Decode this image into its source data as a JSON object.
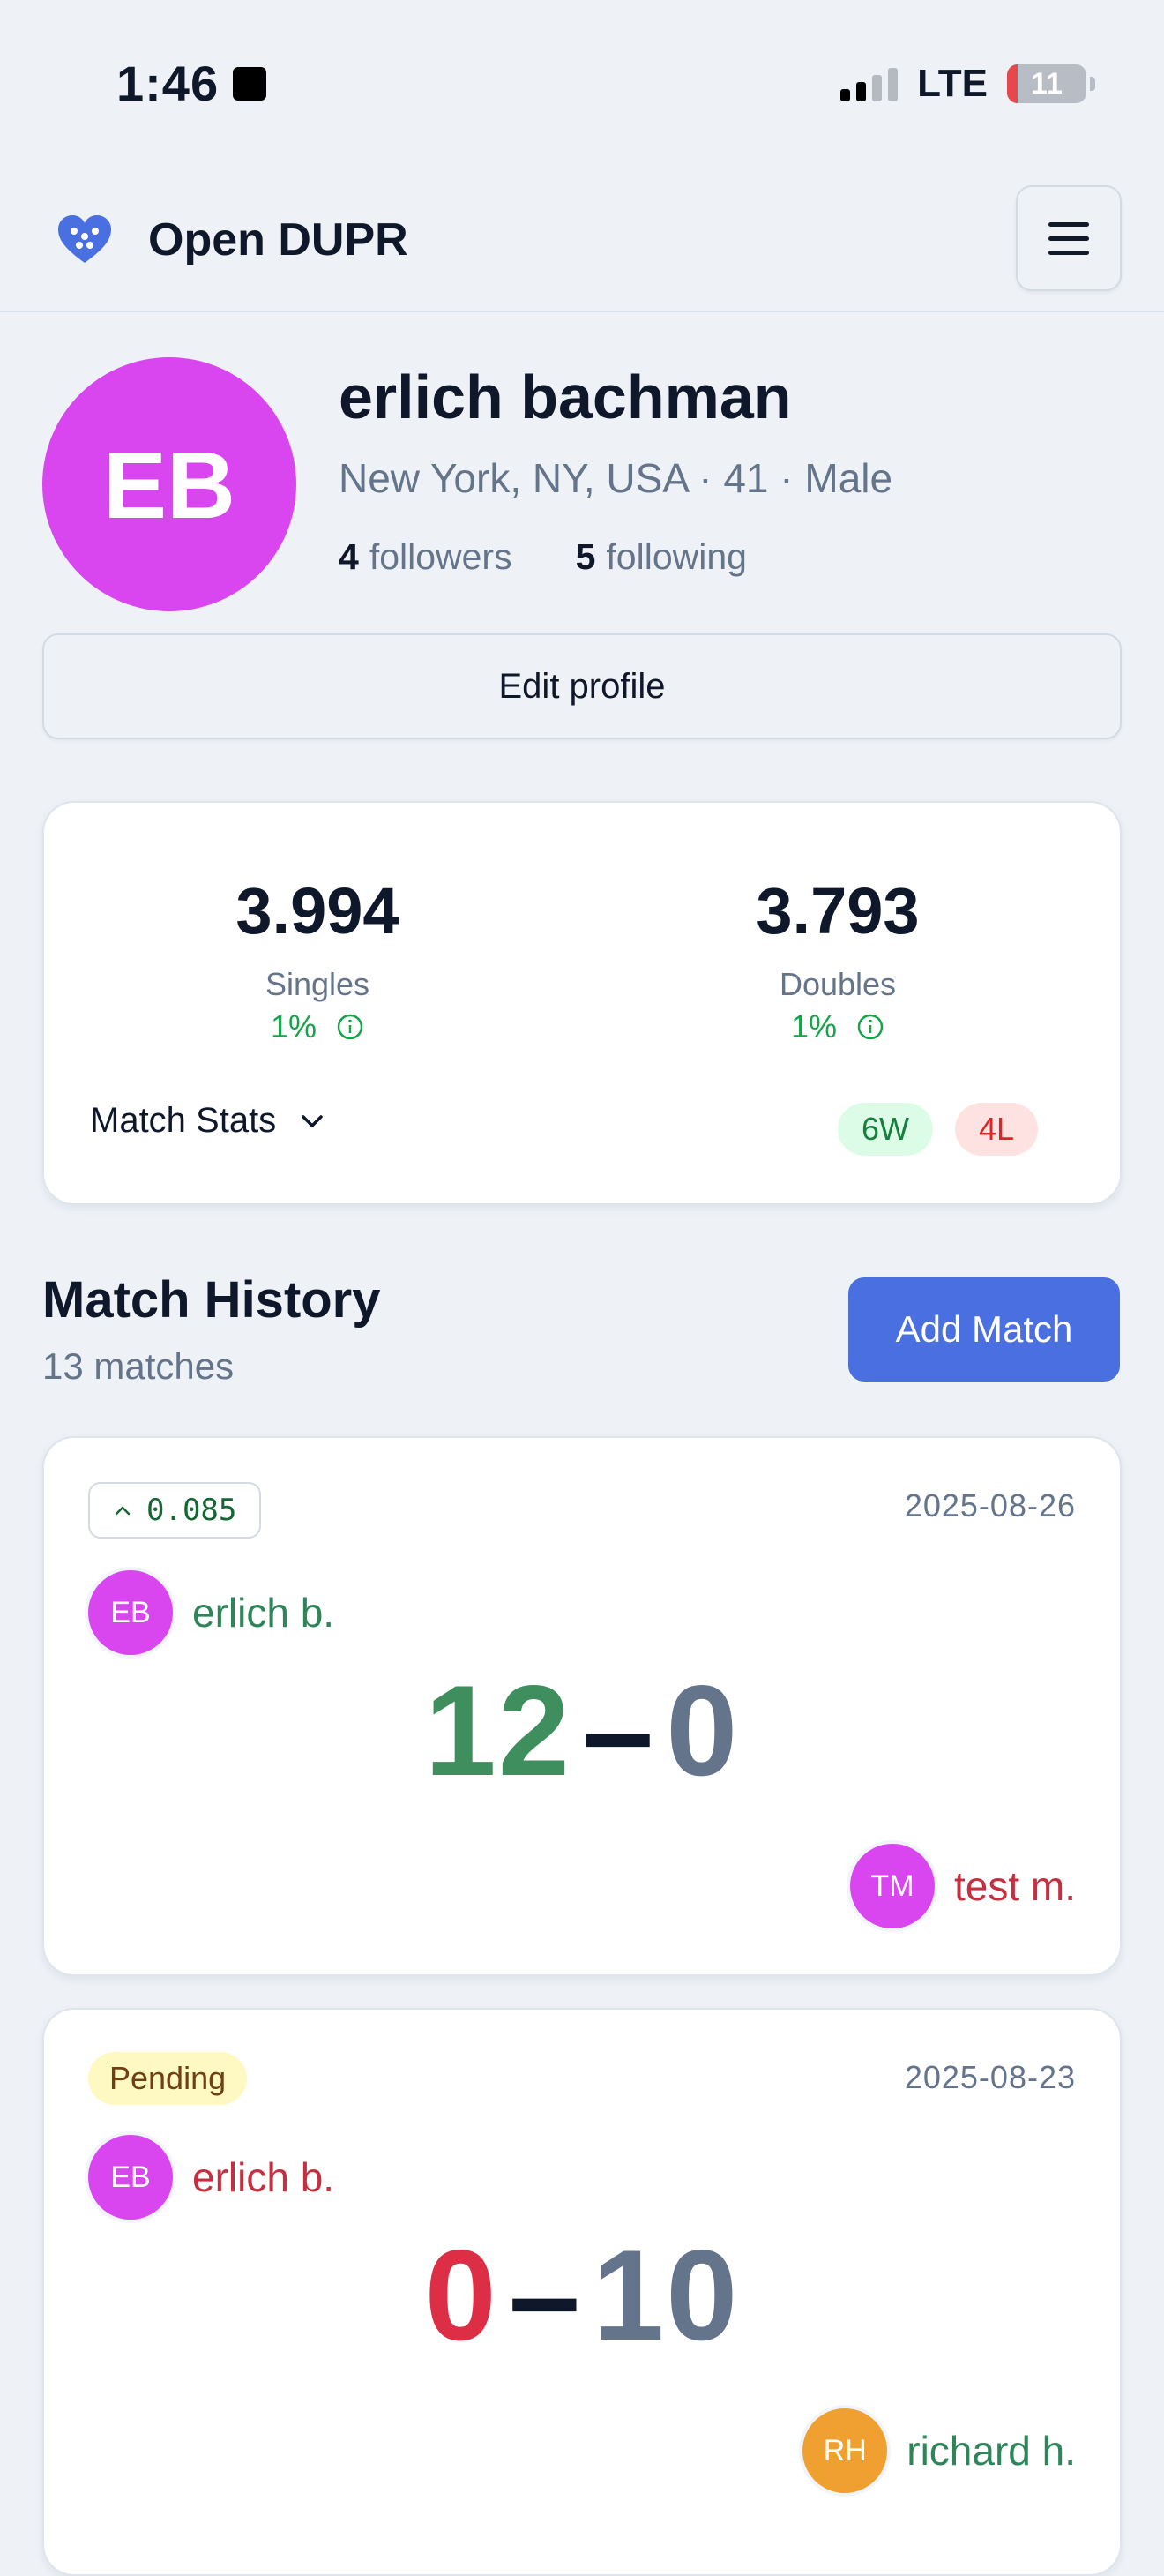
{
  "status_bar": {
    "time": "1:46",
    "network": "LTE",
    "battery": "11"
  },
  "header": {
    "app_title": "Open DUPR",
    "menu_icon": "hamburger-icon",
    "logo_icon": "heart-ball-logo"
  },
  "profile": {
    "initials": "EB",
    "name": "erlich bachman",
    "meta": "New York, NY, USA · 41 · Male",
    "followers_count": "4",
    "followers_label": "followers",
    "following_count": "5",
    "following_label": "following",
    "edit_label": "Edit profile",
    "avatar_color": "#d946ef"
  },
  "ratings": {
    "singles": {
      "value": "3.994",
      "label": "Singles",
      "change": "1%"
    },
    "doubles": {
      "value": "3.793",
      "label": "Doubles",
      "change": "1%"
    },
    "match_stats_label": "Match Stats",
    "wins": "6W",
    "losses": "4L"
  },
  "history": {
    "title": "Match History",
    "count": "13 matches",
    "add_label": "Add Match",
    "accent": "#4a6fe0",
    "matches": [
      {
        "delta": "0.085",
        "date": "2025-08-26",
        "team1": {
          "initials": "EB",
          "name": "erlich b.",
          "color": "#d946ef"
        },
        "team2": {
          "initials": "TM",
          "name": "test m.",
          "color": "#d946ef"
        },
        "score1": "12",
        "separator": "–",
        "score2": "0"
      },
      {
        "status": "Pending",
        "date": "2025-08-23",
        "team1": {
          "initials": "EB",
          "name": "erlich b.",
          "color": "#d946ef"
        },
        "team2": {
          "initials": "RH",
          "name": "richard h.",
          "color": "#f0a030"
        },
        "score1": "0",
        "separator": "–",
        "score2": "10"
      }
    ]
  }
}
